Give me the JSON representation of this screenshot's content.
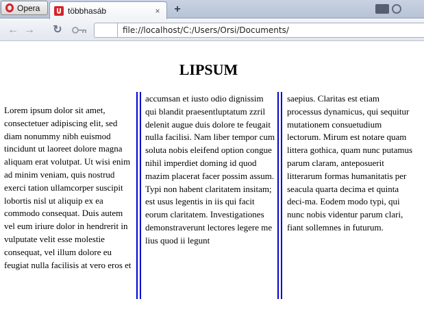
{
  "browser": {
    "menu_button_label": "Opera",
    "tab": {
      "title": "többhasáb",
      "close_glyph": "×"
    },
    "new_tab_glyph": "+",
    "address": "file://localhost/C:/Users/Orsi/Documents/",
    "icons": {
      "back": "back-arrow-icon",
      "forward": "forward-arrow-icon",
      "reload": "reload-icon",
      "key": "key-icon"
    }
  },
  "page": {
    "heading": "LIPSUM",
    "columns": [
      "Lorem ipsum dolor sit amet, consectetuer adipiscing elit, sed diam nonummy nibh euismod tincidunt ut laoreet dolore magna aliquam erat volutpat. Ut wisi enim ad minim veniam, quis nostrud exerci tation ullamcorper suscipit lobortis nisl ut aliquip ex ea commodo consequat. Duis autem vel eum iriure dolor in hendrerit in vulputate velit esse molestie consequat, vel illum dolore eu feugiat nulla facilisis at vero eros et",
      "accumsan et iusto odio dignissim qui blandit praesentluptatum zzril delenit augue duis dolore te feugait nulla facilisi. Nam liber tempor cum soluta nobis eleifend option congue nihil imperdiet doming id quod mazim placerat facer possim assum. Typi non habent claritatem insitam; est usus legentis in iis qui facit eorum claritatem. Investigationes demonstraverunt lectores legere me lius quod ii legunt",
      "saepius. Claritas est etiam processus dynamicus, qui sequitur mutationem consuetudium lectorum. Mirum est notare quam littera gothica, quam nunc putamus parum claram, anteposuerit litterarum formas humanitatis per seacula quarta decima et quinta deci-ma. Eodem modo typi, qui nunc nobis videntur parum clari, fiant sollemnes in futurum."
    ]
  },
  "colors": {
    "column_rule": "#0000cc",
    "opera_red": "#d5232b"
  }
}
